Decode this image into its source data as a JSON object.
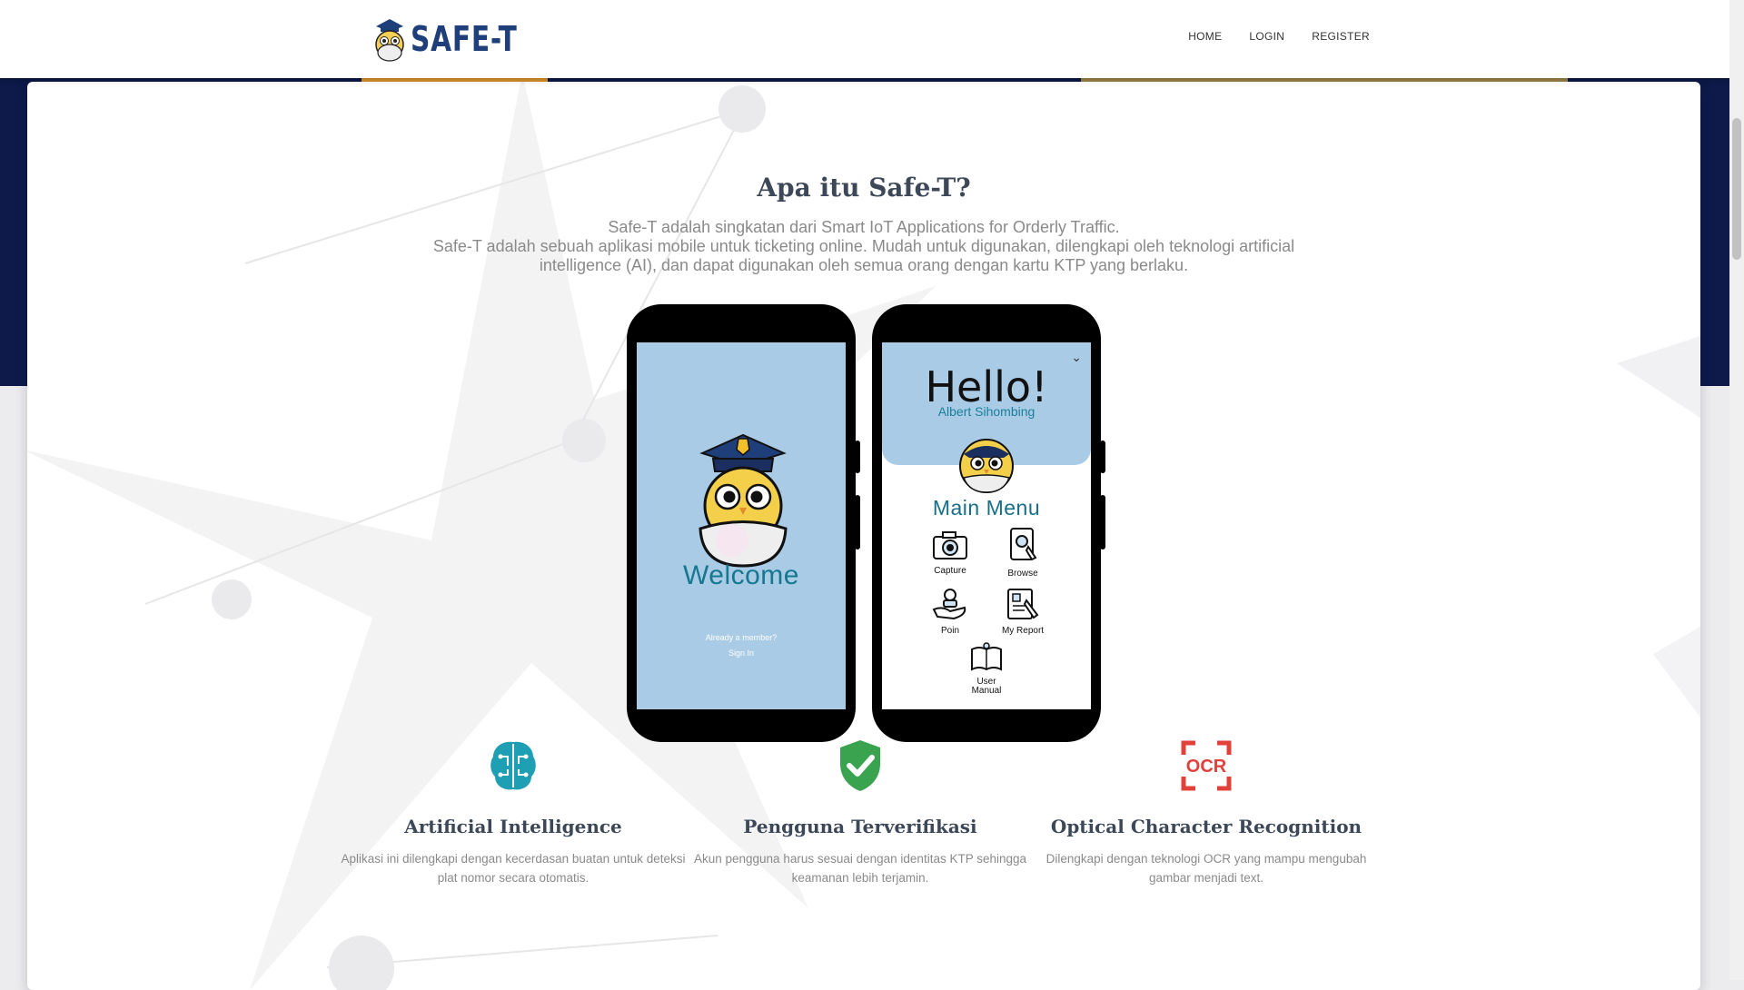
{
  "brand": {
    "name": "SAFE-T",
    "color": "#1f3f7a"
  },
  "nav": {
    "home": "HOME",
    "login": "LOGIN",
    "register": "REGISTER"
  },
  "about": {
    "title": "Apa itu Safe-T?",
    "line1": "Safe-T adalah singkatan dari Smart IoT Applications for Orderly Traffic.",
    "line2": "Safe-T adalah sebuah aplikasi mobile untuk ticketing online. Mudah untuk digunakan, dilengkapi oleh teknologi artificial intelligence (AI), dan dapat digunakan oleh semua orang dengan kartu KTP yang berlaku."
  },
  "phone_welcome": {
    "welcome": "Welcome",
    "member_prompt": "Already a member?",
    "sign_in": "Sign In"
  },
  "phone_menu": {
    "hello": "Hello!",
    "user": "Albert Sihombing",
    "title": "Main Menu",
    "items": [
      {
        "label": "Capture",
        "icon": "camera-icon"
      },
      {
        "label": "Browse",
        "icon": "browse-icon"
      },
      {
        "label": "Poin",
        "icon": "coins-hand-icon"
      },
      {
        "label": "My Report",
        "icon": "report-icon"
      },
      {
        "label": "User Manual",
        "icon": "manual-icon"
      }
    ]
  },
  "features": [
    {
      "title": "Artificial Intelligence",
      "desc": "Aplikasi ini dilengkapi dengan kecerdasan buatan untuk deteksi plat nomor secara otomatis.",
      "icon": "brain-circuit-icon",
      "color": "#1e9fb3"
    },
    {
      "title": "Pengguna Terverifikasi",
      "desc": "Akun pengguna harus sesuai dengan identitas KTP sehingga keamanan lebih terjamin.",
      "icon": "shield-check-icon",
      "color": "#3aa350"
    },
    {
      "title": "Optical Character Recognition",
      "desc": "Dilengkapi dengan teknologi OCR yang mampu mengubah gambar menjadi text.",
      "icon": "ocr-icon",
      "color": "#e0413b"
    }
  ],
  "colors": {
    "hero": "#0d1a4a",
    "accent": "#e59a2c",
    "screen": "#a9cbe6",
    "teal": "#15788f"
  }
}
